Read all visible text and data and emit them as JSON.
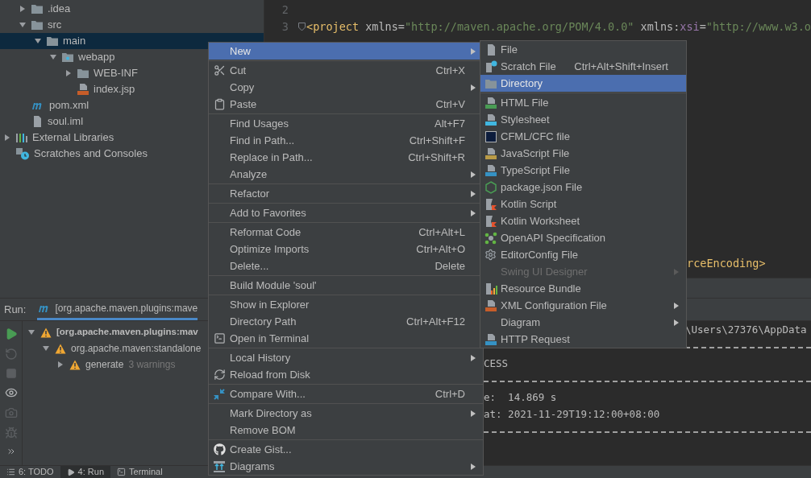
{
  "project_tree": {
    "module_contents": [
      {
        "label": ".idea",
        "kind": "folder",
        "expanded": false,
        "selected": false
      },
      {
        "label": "src",
        "kind": "folder",
        "expanded": true,
        "selected": false,
        "children": [
          {
            "label": "main",
            "kind": "folder",
            "expanded": true,
            "selected": true,
            "children": [
              {
                "label": "webapp",
                "kind": "web-folder",
                "expanded": true,
                "selected": false,
                "children": [
                  {
                    "label": "WEB-INF",
                    "kind": "folder",
                    "expanded": false,
                    "selected": false
                  },
                  {
                    "label": "index.jsp",
                    "kind": "jsp",
                    "selected": false
                  }
                ]
              }
            ]
          }
        ]
      },
      {
        "label": "pom.xml",
        "kind": "maven",
        "selected": false
      },
      {
        "label": "soul.iml",
        "kind": "iml",
        "selected": false
      }
    ],
    "top_level": [
      {
        "label": "External Libraries",
        "kind": "libraries",
        "expanded": false,
        "selected": false
      },
      {
        "label": "Scratches and Consoles",
        "kind": "scratches",
        "selected": false
      }
    ]
  },
  "editor": {
    "lines": [
      {
        "number": "2"
      },
      {
        "number": "3",
        "tokens": [
          {
            "color": "#e8bf6a",
            "text": "<project"
          },
          {
            "color": "#bababa",
            "text": " xmlns="
          },
          {
            "color": "#6a8759",
            "text": "\"http://maven.apache.org/POM/4.0.0\""
          },
          {
            "color": "#bababa",
            "text": " xmlns:"
          },
          {
            "color": "#9876aa",
            "text": "xsi"
          },
          {
            "color": "#bababa",
            "text": "="
          },
          {
            "color": "#6a8759",
            "text": "\"http://www.w3.o"
          }
        ]
      },
      {
        "kind": "tail",
        "tokens": [
          {
            "color": "#e8bf6a",
            "text": "rceEncoding>"
          }
        ]
      }
    ]
  },
  "run": {
    "label": "Run:",
    "tab": "[org.apache.maven.plugins:mave",
    "tree": [
      {
        "label": "[org.apache.maven.plugins:mav",
        "expanded": true,
        "children": [
          {
            "label": "org.apache.maven:standalone",
            "expanded": true,
            "children": [
              {
                "label": "generate",
                "note": "3 warnings",
                "expanded": false
              }
            ]
          }
        ]
      }
    ],
    "console": [
      {
        "kind": "tail",
        "text": "\\Users\\27376\\AppData"
      },
      {
        "kind": "rule"
      },
      {
        "kind": "text",
        "text": "CESS"
      },
      {
        "kind": "rule"
      },
      {
        "kind": "text",
        "text": "e:  14.869 s"
      },
      {
        "kind": "text",
        "text": "at: 2021-11-29T19:12:00+08:00"
      },
      {
        "kind": "rule"
      }
    ]
  },
  "bottom_tabs": [
    {
      "label": "6: TODO",
      "selected": false
    },
    {
      "label": "4: Run",
      "selected": true
    },
    {
      "label": "Terminal",
      "selected": false
    }
  ],
  "context_menu": {
    "groups": [
      [
        {
          "label": "New",
          "submenu": true,
          "selected": true
        }
      ],
      [
        {
          "label": "Cut",
          "shortcut": "Ctrl+X",
          "submenu": false,
          "selected": false
        },
        {
          "label": "Copy",
          "submenu": true,
          "selected": false
        },
        {
          "label": "Paste",
          "shortcut": "Ctrl+V",
          "submenu": false,
          "selected": false
        }
      ],
      [
        {
          "label": "Find Usages",
          "shortcut": "Alt+F7",
          "submenu": false,
          "selected": false
        },
        {
          "label": "Find in Path...",
          "shortcut": "Ctrl+Shift+F",
          "submenu": false,
          "selected": false
        },
        {
          "label": "Replace in Path...",
          "shortcut": "Ctrl+Shift+R",
          "submenu": false,
          "selected": false
        },
        {
          "label": "Analyze",
          "submenu": true,
          "selected": false
        }
      ],
      [
        {
          "label": "Refactor",
          "submenu": true,
          "selected": false
        }
      ],
      [
        {
          "label": "Add to Favorites",
          "submenu": true,
          "selected": false
        }
      ],
      [
        {
          "label": "Reformat Code",
          "shortcut": "Ctrl+Alt+L",
          "submenu": false,
          "selected": false
        },
        {
          "label": "Optimize Imports",
          "shortcut": "Ctrl+Alt+O",
          "submenu": false,
          "selected": false
        },
        {
          "label": "Delete...",
          "shortcut": "Delete",
          "submenu": false,
          "selected": false
        }
      ],
      [
        {
          "label": "Build Module 'soul'",
          "submenu": false,
          "selected": false
        }
      ],
      [
        {
          "label": "Show in Explorer",
          "submenu": false,
          "selected": false
        },
        {
          "label": "Directory Path",
          "shortcut": "Ctrl+Alt+F12",
          "submenu": false,
          "selected": false
        },
        {
          "label": "Open in Terminal",
          "submenu": false,
          "selected": false
        }
      ],
      [
        {
          "label": "Local History",
          "submenu": true,
          "selected": false
        },
        {
          "label": "Reload from Disk",
          "submenu": false,
          "selected": false
        }
      ],
      [
        {
          "label": "Compare With...",
          "shortcut": "Ctrl+D",
          "submenu": false,
          "selected": false
        }
      ],
      [
        {
          "label": "Mark Directory as",
          "submenu": true,
          "selected": false
        },
        {
          "label": "Remove BOM",
          "submenu": false,
          "selected": false
        }
      ],
      [
        {
          "label": "Create Gist...",
          "submenu": false,
          "selected": false
        },
        {
          "label": "Diagrams",
          "submenu": true,
          "selected": false
        }
      ]
    ]
  },
  "new_submenu": {
    "groups": [
      [
        {
          "label": "File",
          "submenu": false,
          "selected": false,
          "disabled": false
        },
        {
          "label": "Scratch File",
          "shortcut": "Ctrl+Alt+Shift+Insert",
          "submenu": false,
          "selected": false,
          "disabled": false
        },
        {
          "label": "Directory",
          "submenu": false,
          "selected": true,
          "disabled": false
        }
      ],
      [
        {
          "label": "HTML File",
          "submenu": false,
          "selected": false,
          "disabled": false
        },
        {
          "label": "Stylesheet",
          "submenu": false,
          "selected": false,
          "disabled": false
        },
        {
          "label": "CFML/CFC file",
          "submenu": false,
          "selected": false,
          "disabled": false
        },
        {
          "label": "JavaScript File",
          "submenu": false,
          "selected": false,
          "disabled": false
        },
        {
          "label": "TypeScript File",
          "submenu": false,
          "selected": false,
          "disabled": false
        },
        {
          "label": "package.json File",
          "submenu": false,
          "selected": false,
          "disabled": false
        },
        {
          "label": "Kotlin Script",
          "submenu": false,
          "selected": false,
          "disabled": false
        },
        {
          "label": "Kotlin Worksheet",
          "submenu": false,
          "selected": false,
          "disabled": false
        },
        {
          "label": "OpenAPI Specification",
          "submenu": false,
          "selected": false,
          "disabled": false
        },
        {
          "label": "EditorConfig File",
          "submenu": false,
          "selected": false,
          "disabled": false
        },
        {
          "label": "Swing UI Designer",
          "submenu": true,
          "selected": false,
          "disabled": true
        },
        {
          "label": "Resource Bundle",
          "submenu": false,
          "selected": false,
          "disabled": false
        },
        {
          "label": "XML Configuration File",
          "submenu": true,
          "selected": false,
          "disabled": false
        },
        {
          "label": "Diagram",
          "submenu": true,
          "selected": false,
          "disabled": false
        },
        {
          "label": "HTTP Request",
          "submenu": false,
          "selected": false,
          "disabled": false
        }
      ]
    ]
  }
}
